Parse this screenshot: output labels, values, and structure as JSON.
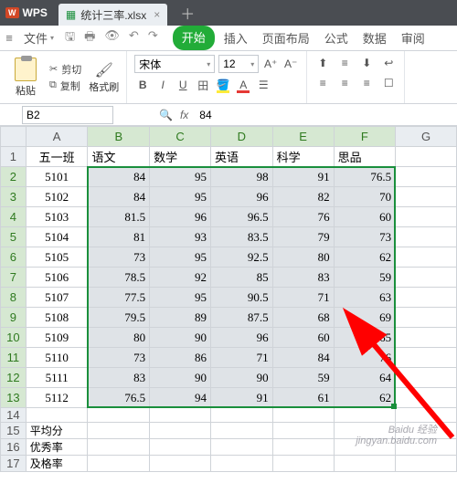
{
  "title_tab": "统计三率.xlsx",
  "wps_brand": "WPS",
  "menu": {
    "file": "文件",
    "tabs": [
      "开始",
      "插入",
      "页面布局",
      "公式",
      "数据",
      "审阅"
    ]
  },
  "ribbon": {
    "paste": "粘贴",
    "cut": "剪切",
    "copy": "复制",
    "format_painter": "格式刷",
    "font_name": "宋体",
    "font_size": "12"
  },
  "name_box": "B2",
  "formula_value": "84",
  "columns": [
    "A",
    "B",
    "C",
    "D",
    "E",
    "F",
    "G"
  ],
  "headers": {
    "class": "五一班",
    "subjects": [
      "语文",
      "数学",
      "英语",
      "科学",
      "思品"
    ]
  },
  "summary_labels": [
    "平均分",
    "优秀率",
    "及格率"
  ],
  "watermark": {
    "line1": "Baidu 经验",
    "line2": "jingyan.baidu.com"
  },
  "chart_data": {
    "type": "table",
    "columns": [
      "语文",
      "数学",
      "英语",
      "科学",
      "思品"
    ],
    "rows": [
      {
        "id": "5101",
        "values": [
          84,
          95,
          98,
          91,
          76.5
        ]
      },
      {
        "id": "5102",
        "values": [
          84,
          95,
          96,
          82,
          70
        ]
      },
      {
        "id": "5103",
        "values": [
          81.5,
          96,
          96.5,
          76,
          60
        ]
      },
      {
        "id": "5104",
        "values": [
          81,
          93,
          83.5,
          79,
          73
        ]
      },
      {
        "id": "5105",
        "values": [
          73,
          95,
          92.5,
          80,
          62
        ]
      },
      {
        "id": "5106",
        "values": [
          78.5,
          92,
          85,
          83,
          59
        ]
      },
      {
        "id": "5107",
        "values": [
          77.5,
          95,
          90.5,
          71,
          63
        ]
      },
      {
        "id": "5108",
        "values": [
          79.5,
          89,
          87.5,
          68,
          69
        ]
      },
      {
        "id": "5109",
        "values": [
          80,
          90,
          96,
          60,
          65
        ]
      },
      {
        "id": "5110",
        "values": [
          73,
          86,
          71,
          84,
          76
        ]
      },
      {
        "id": "5111",
        "values": [
          83,
          90,
          90,
          59,
          64
        ]
      },
      {
        "id": "5112",
        "values": [
          76.5,
          94,
          91,
          61,
          62
        ]
      }
    ]
  }
}
